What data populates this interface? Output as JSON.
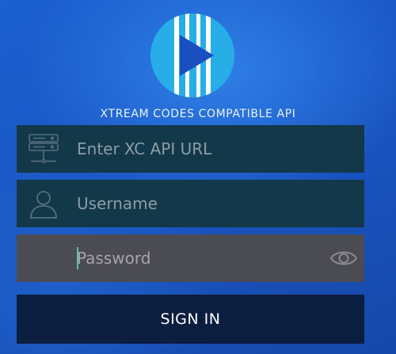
{
  "logo": {
    "icon": "xc-play-logo-icon",
    "circle_color": "#27aee9",
    "stripe_color": "#ffffff",
    "play_color": "#1a4fc0"
  },
  "tagline": "XTREAM CODES COMPATIBLE API",
  "form": {
    "url": {
      "placeholder": "Enter XC API URL",
      "value": "",
      "icon": "server-icon"
    },
    "username": {
      "placeholder": "Username",
      "value": "",
      "icon": "user-icon"
    },
    "password": {
      "placeholder": "Password",
      "value": "",
      "toggle_icon": "eye-icon"
    }
  },
  "signin_label": "SIGN IN",
  "colors": {
    "background": "#1a56c4",
    "field_bg": "#133849",
    "focused_field_bg": "#4b4b52",
    "button_bg": "#0c1e3f",
    "caret": "#4fc3b0"
  }
}
